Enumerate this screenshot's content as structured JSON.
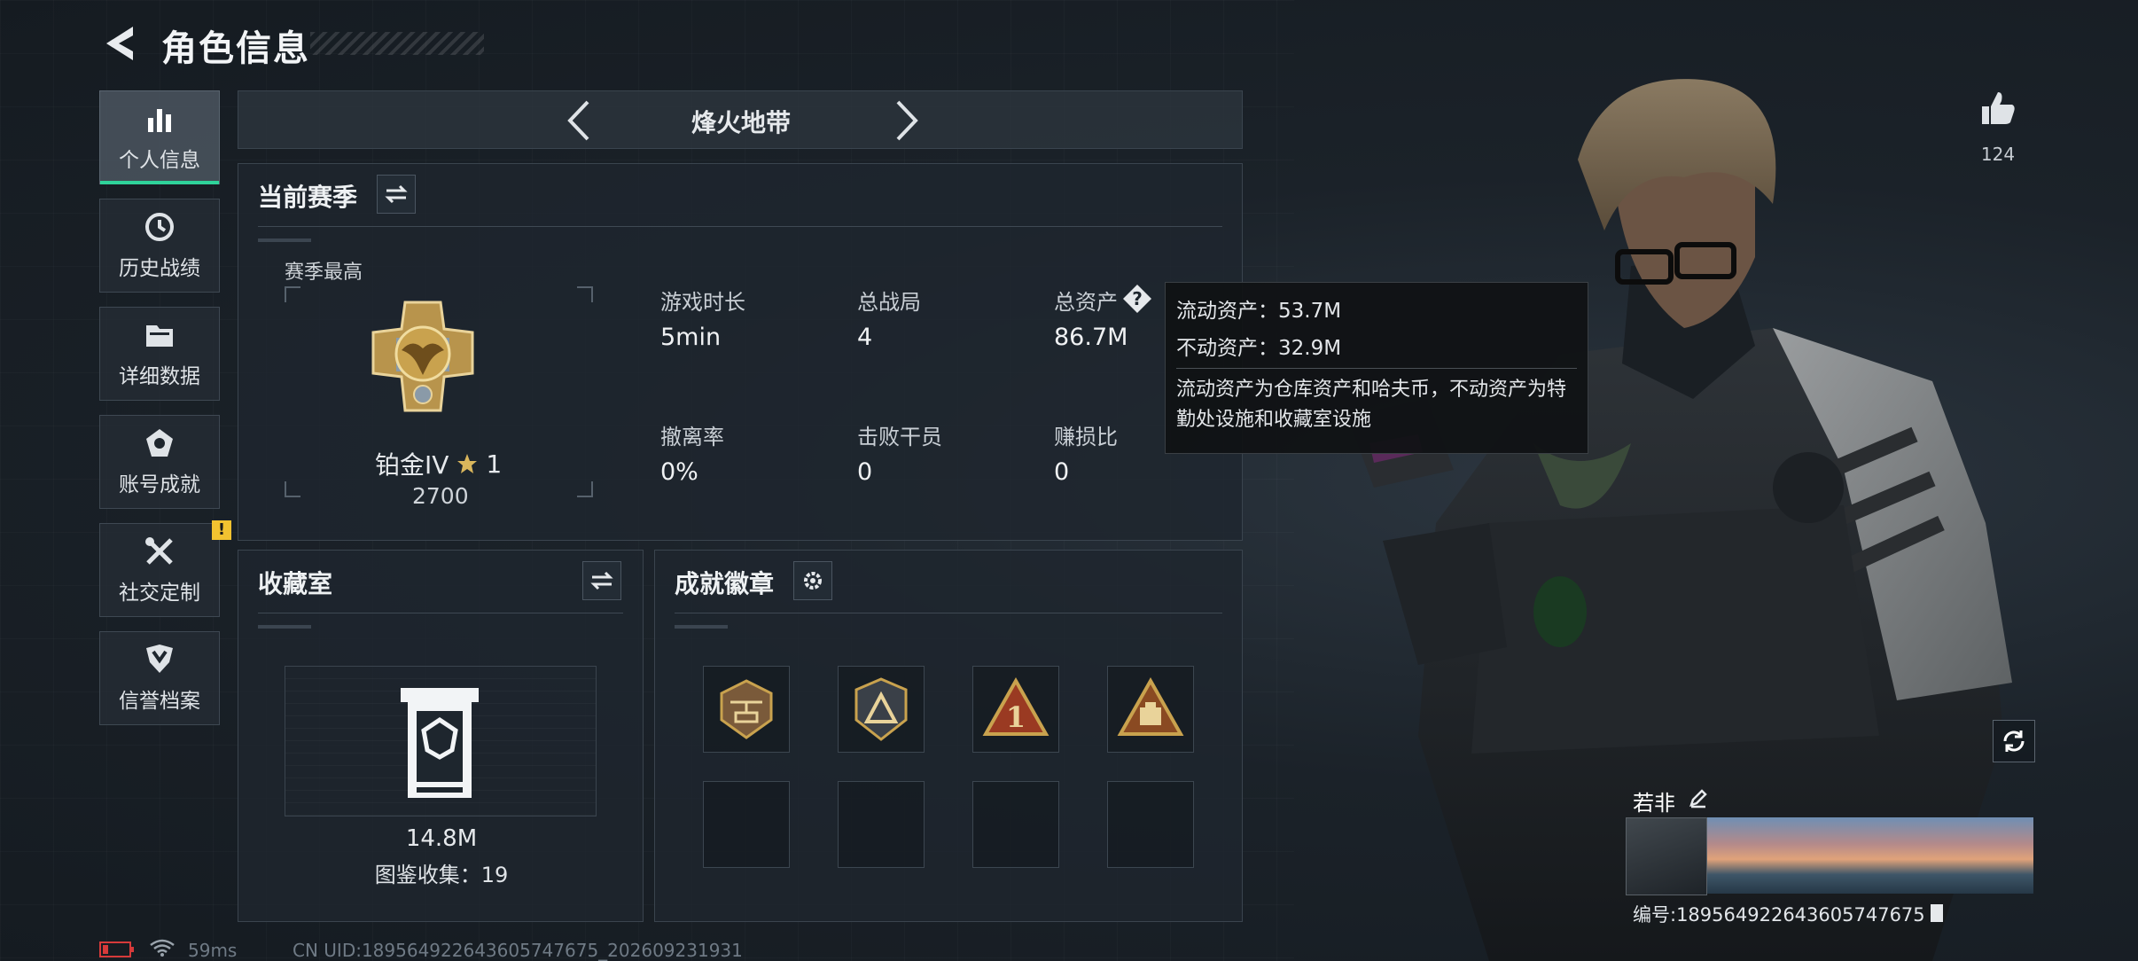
{
  "header": {
    "title": "角色信息"
  },
  "sidebar": {
    "items": [
      {
        "label": "个人信息",
        "icon": "bar-chart-icon",
        "active": true
      },
      {
        "label": "历史战绩",
        "icon": "clock-icon"
      },
      {
        "label": "详细数据",
        "icon": "folder-icon"
      },
      {
        "label": "账号成就",
        "icon": "achievement-icon"
      },
      {
        "label": "社交定制",
        "icon": "tools-icon",
        "badge": "!"
      },
      {
        "label": "信誉档案",
        "icon": "shield-badge-icon"
      }
    ]
  },
  "mode_selector": {
    "label": "烽火地带"
  },
  "season": {
    "title": "当前赛季",
    "best_label": "赛季最高",
    "rank_name": "铂金IV",
    "rank_stars": "1",
    "rank_points": "2700",
    "stats": [
      {
        "label": "游戏时长",
        "value": "5min"
      },
      {
        "label": "总战局",
        "value": "4"
      },
      {
        "label": "总资产",
        "value": "86.7M"
      },
      {
        "label": "撤离率",
        "value": "0%"
      },
      {
        "label": "击败干员",
        "value": "0"
      },
      {
        "label": "赚损比",
        "value": "0"
      }
    ]
  },
  "tooltip": {
    "liquid": "流动资产：53.7M",
    "fixed": "不动资产：32.9M",
    "description": "流动资产为仓库资产和哈夫币，不动资产为特勤处设施和收藏室设施"
  },
  "collection": {
    "title": "收藏室",
    "value": "14.8M",
    "catalog": "图鉴收集：19"
  },
  "badges": {
    "title": "成就徽章"
  },
  "profile": {
    "likes": "124",
    "name": "若非",
    "id": "编号:1895649226436057476​75"
  },
  "status_bar": {
    "ping": "59ms",
    "uid": "CN UID:18956492264360574767​5_202609231931"
  },
  "colors": {
    "accent": "#2fd39a",
    "badge": "#f2c230",
    "gold": "#c9a24e"
  }
}
